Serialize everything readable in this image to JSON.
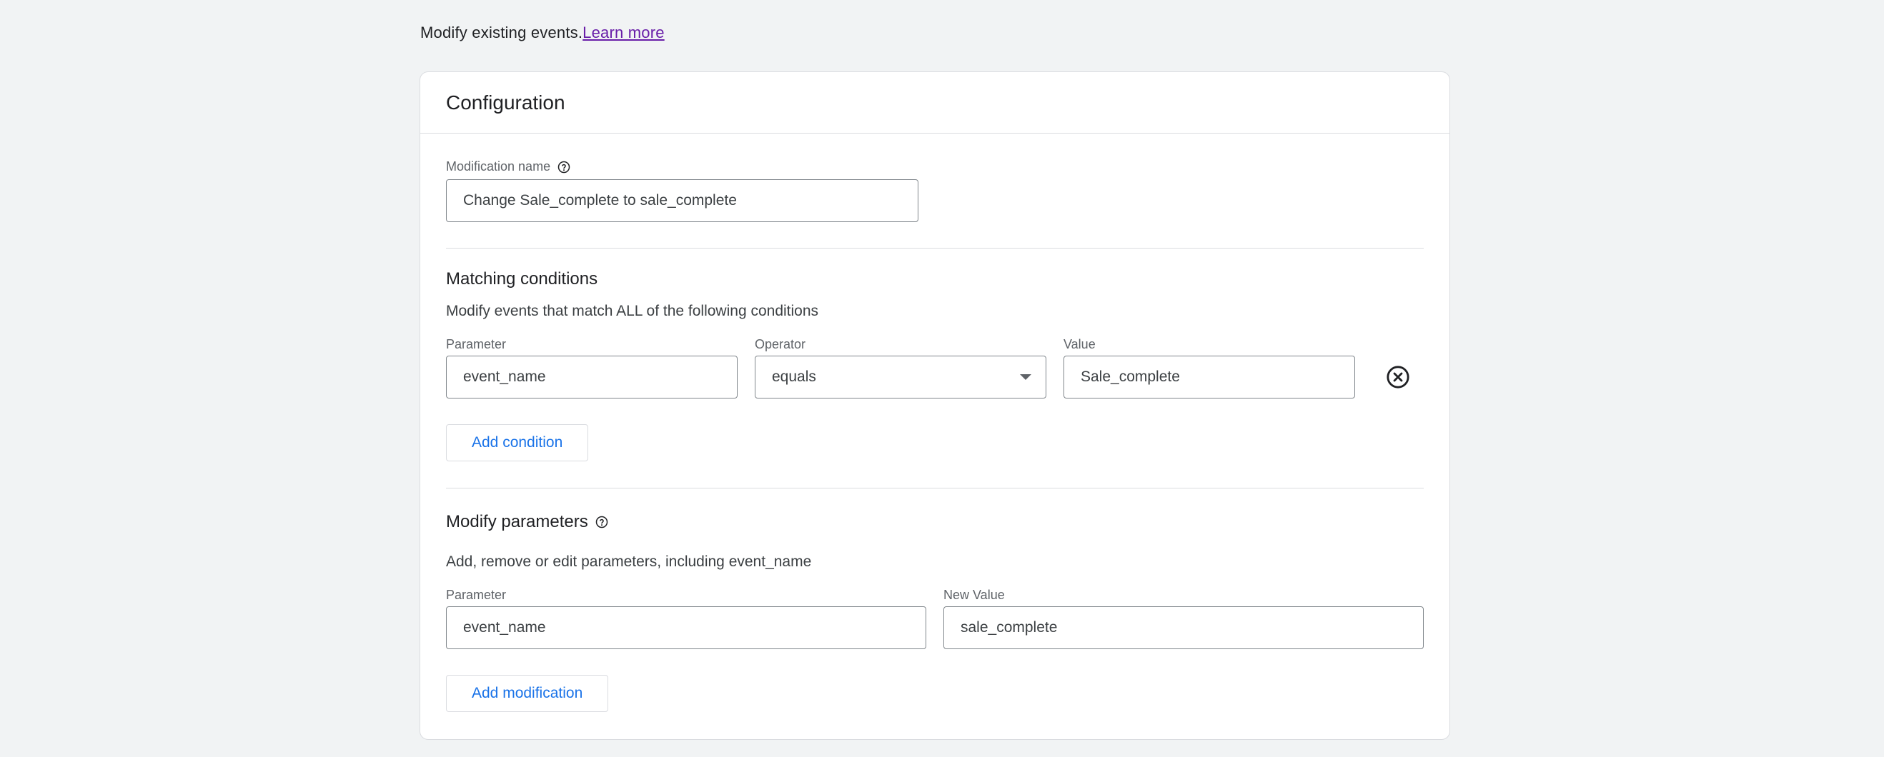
{
  "intro": {
    "text": "Modify existing events.",
    "link": "Learn more"
  },
  "config": {
    "title": "Configuration",
    "modification_name_label": "Modification name",
    "modification_name_value": "Change Sale_complete to sale_complete"
  },
  "matching": {
    "title": "Matching conditions",
    "description": "Modify events that match ALL of the following conditions",
    "parameter_label": "Parameter",
    "parameter_value": "event_name",
    "operator_label": "Operator",
    "operator_value": "equals",
    "value_label": "Value",
    "value_value": "Sale_complete",
    "add_condition": "Add condition"
  },
  "modify": {
    "title": "Modify parameters",
    "description": "Add, remove or edit parameters, including event_name",
    "parameter_label": "Parameter",
    "parameter_value": "event_name",
    "new_value_label": "New Value",
    "new_value_value": "sale_complete",
    "add_modification": "Add modification"
  },
  "icons": {
    "help": "help-circle-icon",
    "remove": "close-circle-icon",
    "dropdown": "caret-down-icon"
  }
}
